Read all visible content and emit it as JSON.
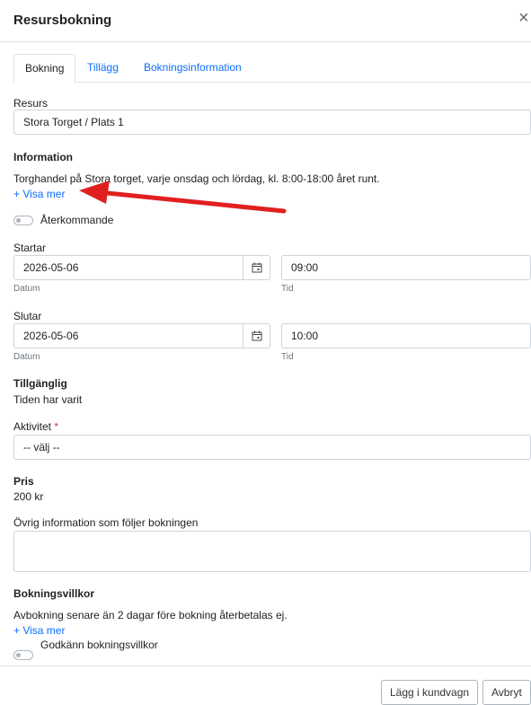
{
  "header": {
    "title": "Resursbokning",
    "close_glyph": "×"
  },
  "tabs": [
    {
      "label": "Bokning",
      "active": true
    },
    {
      "label": "Tillägg",
      "active": false
    },
    {
      "label": "Bokningsinformation",
      "active": false
    }
  ],
  "resource": {
    "label": "Resurs",
    "value": "Stora Torget / Plats 1"
  },
  "information": {
    "heading": "Information",
    "text": "Torghandel på Stora torget, varje onsdag och lördag, kl. 8:00-18:00 året runt.",
    "show_more": "+ Visa mer"
  },
  "recurring": {
    "label": "Återkommande",
    "checked": false
  },
  "start": {
    "label": "Startar",
    "date": "2026-05-06",
    "date_sub": "Datum",
    "time": "09:00",
    "time_sub": "Tid"
  },
  "end": {
    "label": "Slutar",
    "date": "2026-05-06",
    "date_sub": "Datum",
    "time": "10:00",
    "time_sub": "Tid"
  },
  "availability": {
    "heading": "Tillgänglig",
    "text": "Tiden har varit"
  },
  "activity": {
    "label": "Aktivitet",
    "required_mark": "*",
    "value": "-- välj --"
  },
  "price": {
    "heading": "Pris",
    "value": "200 kr"
  },
  "other_info": {
    "label": "Övrig information som följer bokningen",
    "value": ""
  },
  "terms": {
    "heading": "Bokningsvillkor",
    "text": "Avbokning senare än 2 dagar före bokning återbetalas ej.",
    "show_more": "+ Visa mer",
    "accept_label": "Godkänn bokningsvillkor",
    "accepted": false
  },
  "footer": {
    "add_to_cart": "Lägg i kundvagn",
    "cancel": "Avbryt"
  },
  "colors": {
    "link": "#0d6efd",
    "arrow": "#e02020",
    "required": "#dc3545"
  }
}
